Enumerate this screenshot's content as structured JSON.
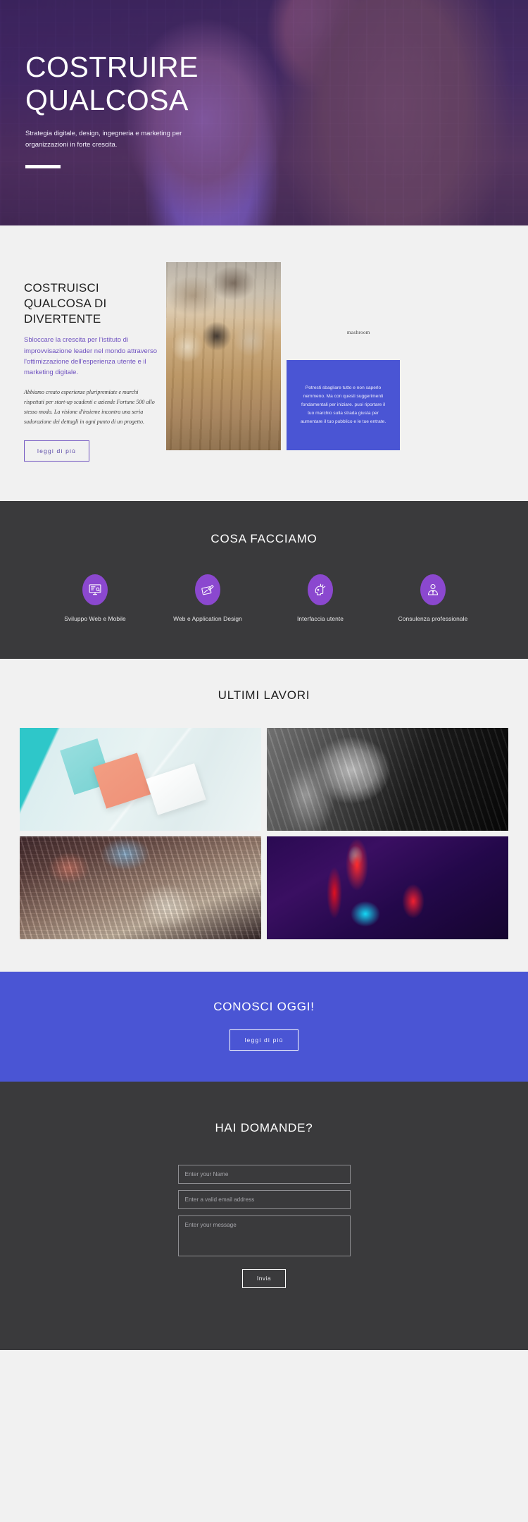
{
  "hero": {
    "title_line1": "COSTRUIRE",
    "title_line2": "QUALCOSA",
    "subtitle": "Strategia digitale, design, ingegneria e marketing per organizzazioni in forte crescita."
  },
  "about": {
    "title": "COSTRUISCI QUALCOSA DI DIVERTENTE",
    "lead": "Sbloccare la crescita per l'istituto di improvvisazione leader nel mondo attraverso l'ottimizzazione dell'esperienza utente e il marketing digitale.",
    "body": "Abbiamo creato esperienze pluripremiate e marchi rispettati per start-up scadenti e aziende Fortune 500 allo stesso modo. La visione d'insieme incontra una seria sudorazione dei dettagli in ogni punto di un progetto.",
    "button_label": "leggi di più",
    "image_lamp_sign": "mashroom",
    "quote": "Potresti sbagliare tutto e non saperlo nemmeno. Ma con questi suggerimenti fondamentali per iniziare. puoi riportare il tuo marchio sulla strada giusta per aumentare il tuo pubblico e le tue entrate."
  },
  "services": {
    "title": "COSA FACCIAMO",
    "items": [
      {
        "label": "Sviluppo Web e Mobile",
        "icon": "monitor-code-icon"
      },
      {
        "label": "Web e Application Design",
        "icon": "pen-tablet-icon"
      },
      {
        "label": "Interfaccia utente",
        "icon": "head-idea-icon"
      },
      {
        "label": "Consulenza professionale",
        "icon": "consultant-person-icon"
      }
    ]
  },
  "portfolio": {
    "title": "ULTIMI LAVORI",
    "tiles": [
      {
        "name": "branding-stationery"
      },
      {
        "name": "black-white-portrait"
      },
      {
        "name": "city-motion-blur"
      },
      {
        "name": "neon-abstract"
      }
    ]
  },
  "cta": {
    "title": "CONOSCI OGGI!",
    "button_label": "leggi di più"
  },
  "contact": {
    "title": "HAI DOMANDE?",
    "name_placeholder": "Enter your Name",
    "email_placeholder": "Enter a valid email address",
    "message_placeholder": "Enter your message",
    "submit_label": "Invia"
  },
  "colors": {
    "hero_purple": "#7e4ec4",
    "accent_violet": "#6f52c0",
    "blue": "#4a55d4",
    "dark": "#3a3a3c",
    "icon_purple": "#8b48cf",
    "light_bg": "#f1f1f1"
  }
}
